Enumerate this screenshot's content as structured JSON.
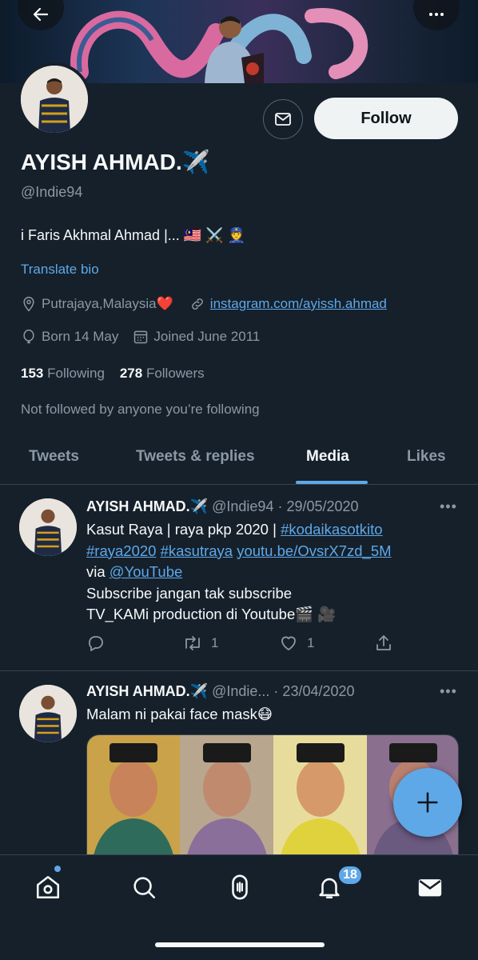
{
  "profile": {
    "name": "AYISH AHMAD.✈️",
    "handle": "@Indie94",
    "bio": "i Faris Akhmal Ahmad |... 🇲🇾 ⚔️ 👮",
    "translate_label": "Translate bio",
    "location": "Putrajaya,Malaysia❤️",
    "website": "instagram.com/ayissh.ahmad",
    "birthday": "Born 14 May",
    "joined": "Joined June 2011",
    "following_count": "153",
    "following_label": "Following",
    "followers_count": "278",
    "followers_label": "Followers",
    "not_followed_text": "Not followed by anyone you’re following",
    "follow_button": "Follow"
  },
  "tabs": [
    {
      "label": "Tweets"
    },
    {
      "label": "Tweets & replies"
    },
    {
      "label": "Media"
    },
    {
      "label": "Likes"
    }
  ],
  "active_tab": "Media",
  "tweets": [
    {
      "name": "AYISH AHMAD.✈️",
      "handle_date": "@Indie94 · 29/05/2020",
      "line1": "Kasut Raya | raya pkp 2020 | ",
      "tag1": "#kodaikasotkito",
      "tag2": "#raya2020",
      "tag3": "#kasutraya",
      "link1": "youtu.be/OvsrX7zd_5M",
      "via": "via ",
      "mention": "@YouTube",
      "line3": "Subscribe jangan tak subscribe",
      "line4": "TV_KAMi production di Youtube🎬 🎥",
      "retweets": "1",
      "likes": "1"
    },
    {
      "name": "AYISH AHMAD.✈️",
      "handle_date": "@Indie... · 23/04/2020",
      "text": "Malam ni pakai face mask😷"
    }
  ],
  "more_label": "•••",
  "notifications_badge": "18",
  "colors": {
    "background": "#15202b",
    "accent": "#5fa8e8",
    "secondary_text": "#8b98a5"
  }
}
